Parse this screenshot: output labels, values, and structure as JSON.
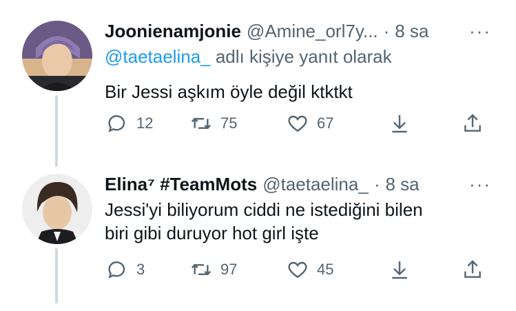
{
  "tweets": [
    {
      "name": "Joonienamjonie",
      "handle": "@Amine_orl7y...",
      "dot": "·",
      "time": "8 sa",
      "reply_mention": "@taetaelina_",
      "reply_suffix": " adlı kişiye yanıt olarak",
      "text": "Bir Jessi aşkım öyle değil ktktkt",
      "replies": "12",
      "retweets": "75",
      "likes": "67"
    },
    {
      "name": "Elina⁷ #TeamMots",
      "handle": "@taetaelina_",
      "dot": "·",
      "time": "8 sa",
      "text_line1": "Jessi'yi biliyorum ciddi ne istediğini bilen",
      "text_line2": "biri gibi duruyor hot girl işte",
      "replies": "3",
      "retweets": "97",
      "likes": "45"
    }
  ],
  "more_glyph": "···",
  "colors": {
    "accent": "#1d9bf0",
    "muted": "#536471",
    "line": "#cfd9de"
  }
}
